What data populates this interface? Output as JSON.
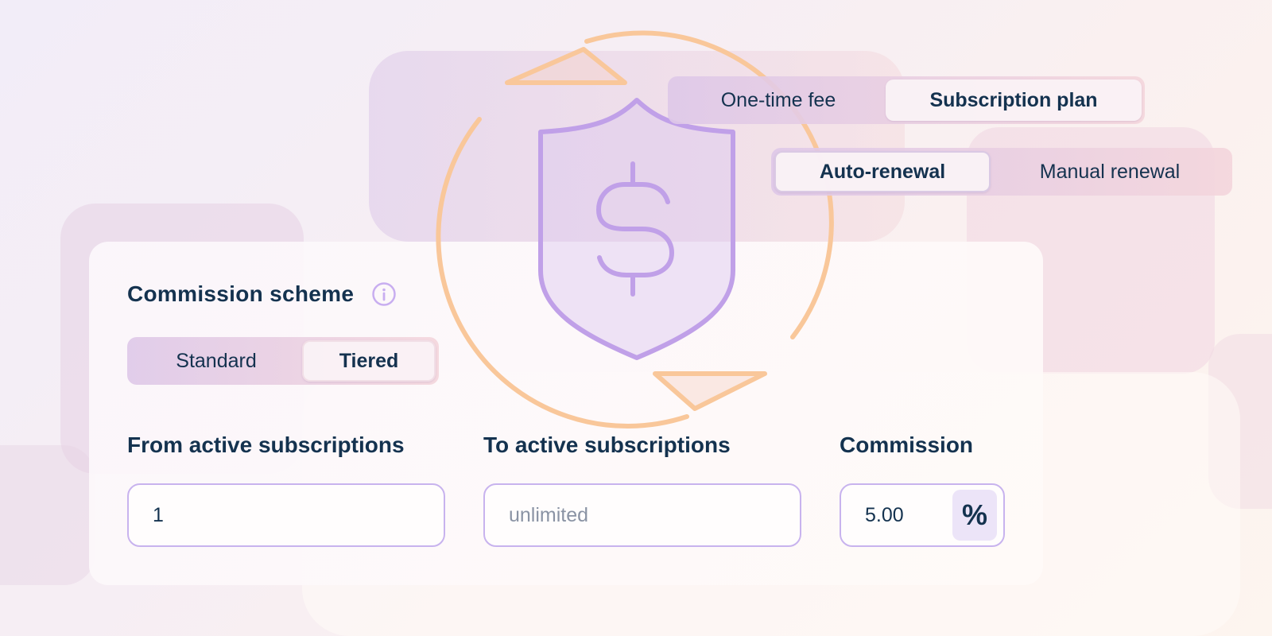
{
  "colors": {
    "text_primary": "#14324f",
    "placeholder": "#8a93a4",
    "accent_purple": "#c0a0e8",
    "accent_orange": "#f9c79a",
    "field_border": "#c8b3ee",
    "percent_bg": "#ece4f8"
  },
  "payment_type": {
    "options": [
      {
        "label": "One-time fee",
        "selected": false
      },
      {
        "label": "Subscription plan",
        "selected": true
      }
    ]
  },
  "renewal": {
    "options": [
      {
        "label": "Auto-renewal",
        "selected": true
      },
      {
        "label": "Manual renewal",
        "selected": false
      }
    ]
  },
  "illustration": {
    "center_icon": "shield-dollar-icon",
    "ring_icon": "refresh-cycle-icon"
  },
  "commission_scheme": {
    "title": "Commission scheme",
    "info_icon": "info-icon",
    "options": [
      {
        "label": "Standard",
        "selected": false
      },
      {
        "label": "Tiered",
        "selected": true
      }
    ]
  },
  "tier": {
    "from": {
      "label": "From active subscriptions",
      "value": "1",
      "placeholder": ""
    },
    "to": {
      "label": "To active subscriptions",
      "value": "",
      "placeholder": "unlimited"
    },
    "commission": {
      "label": "Commission",
      "value": "5.00",
      "unit": "%"
    }
  }
}
